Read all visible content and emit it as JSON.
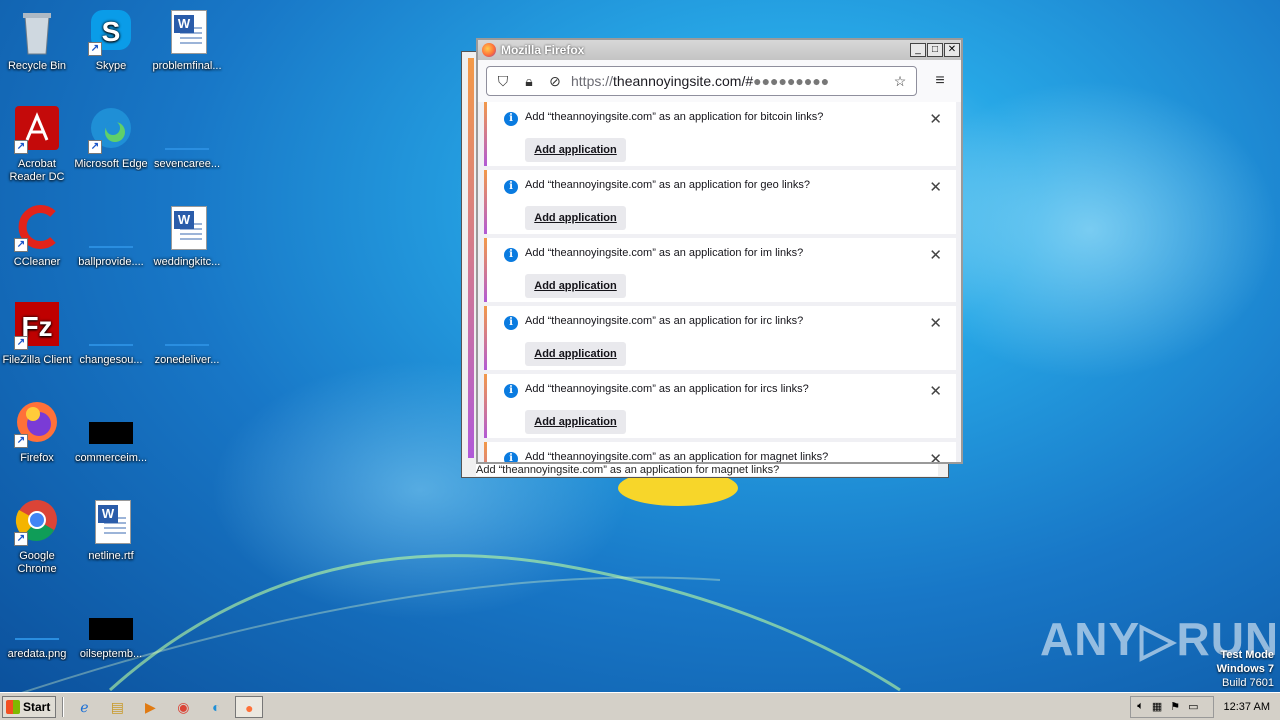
{
  "desktop": {
    "icons": [
      {
        "label": "Recycle Bin",
        "icon": "recycle-bin-icon"
      },
      {
        "label": "Skype",
        "icon": "skype-icon"
      },
      {
        "label": "problemfinal...",
        "icon": "word-document-icon"
      },
      {
        "label": "Acrobat Reader DC",
        "icon": "acrobat-icon"
      },
      {
        "label": "Microsoft Edge",
        "icon": "edge-icon"
      },
      {
        "label": "sevencaree...",
        "icon": "blank-file-icon"
      },
      {
        "label": "CCleaner",
        "icon": "ccleaner-icon"
      },
      {
        "label": "ballprovide....",
        "icon": "blank-file-icon"
      },
      {
        "label": "weddingkitc...",
        "icon": "word-document-icon"
      },
      {
        "label": "FileZilla Client",
        "icon": "filezilla-icon"
      },
      {
        "label": "changesou...",
        "icon": "blank-file-icon"
      },
      {
        "label": "zonedeliver...",
        "icon": "blank-file-icon"
      },
      {
        "label": "Firefox",
        "icon": "firefox-icon"
      },
      {
        "label": "commerceim...",
        "icon": "black-file-icon"
      },
      {
        "label": "Google Chrome",
        "icon": "chrome-icon"
      },
      {
        "label": "netline.rtf",
        "icon": "word-document-icon"
      },
      {
        "label": "aredata.png",
        "icon": "blank-file-icon"
      },
      {
        "label": "oilseptemb...",
        "icon": "black-file-icon"
      }
    ]
  },
  "firefox": {
    "title": "Mozilla Firefox",
    "url_scheme": "https://",
    "url_host": "theannoyingsite.com/#",
    "url_tail": "●●●●●●●●●",
    "notification_prefix": "Add “theannoyingsite.com” as an application for ",
    "button_label": "Add application",
    "notifications": [
      {
        "text": "Add “theannoyingsite.com” as an application for bitcoin links?"
      },
      {
        "text": "Add “theannoyingsite.com” as an application for geo links?"
      },
      {
        "text": "Add “theannoyingsite.com” as an application for im links?"
      },
      {
        "text": "Add “theannoyingsite.com” as an application for irc links?"
      },
      {
        "text": "Add “theannoyingsite.com” as an application for ircs links?"
      },
      {
        "text": "Add “theannoyingsite.com” as an application for magnet links?"
      }
    ],
    "back_window_last": "Add “theannoyingsite.com” as an application for magnet links?"
  },
  "watermark": {
    "brand": "ANY▷RUN",
    "test_mode": "Test Mode",
    "os": "Windows 7",
    "build": "Build 7601"
  },
  "taskbar": {
    "start_label": "Start",
    "clock": "12:37 AM"
  }
}
